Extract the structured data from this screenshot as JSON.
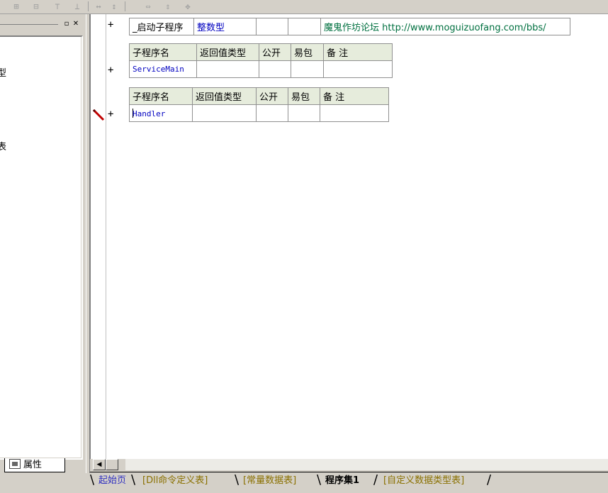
{
  "toolbar": {
    "icons": [
      "align-left-icon",
      "align-center-icon",
      "align-top-icon",
      "align-bottom-icon",
      "same-width-icon",
      "same-height-icon",
      "center-horizontal-icon",
      "center-vertical-icon",
      "center-both-icon"
    ]
  },
  "left_panel": {
    "tree_items": [
      "型",
      "表"
    ],
    "tab_label": "属性"
  },
  "editor": {
    "program_row": {
      "plus": "+",
      "name": "_启动子程序",
      "type": "整数型",
      "public": "",
      "easy_pack": "",
      "note": "魔鬼作坊论坛 http://www.moguizuofang.com/bbs/"
    },
    "subroutine_headers": [
      "子程序名",
      "返回值类型",
      "公开",
      "易包",
      "备 注"
    ],
    "subroutines": [
      {
        "plus": "+",
        "name": "ServiceMain",
        "return_type": "",
        "public": "",
        "easy_pack": "",
        "note": ""
      },
      {
        "plus": "+",
        "name": "Handler",
        "return_type": "",
        "public": "",
        "easy_pack": "",
        "note": ""
      }
    ]
  },
  "tabs": [
    {
      "label": "起始页",
      "color": "#3030c0"
    },
    {
      "label": "[Dll命令定义表]",
      "color": "#8a7000"
    },
    {
      "label": "[常量数据表]",
      "color": "#8a7000"
    },
    {
      "label": "程序集1",
      "color": "#000000",
      "active": true
    },
    {
      "label": "[自定义数据类型表]",
      "color": "#8a7000"
    }
  ],
  "colors": {
    "header_bg": "#e6ecdc",
    "name_blue": "#0000c0",
    "note_green": "#007040"
  }
}
